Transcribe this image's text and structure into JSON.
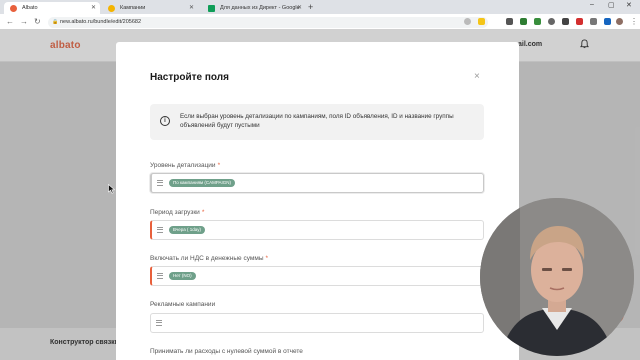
{
  "browser": {
    "tabs": [
      {
        "title": "Albato",
        "favicon_color": "#e8603c",
        "active": true
      },
      {
        "title": "Кампании",
        "favicon_color": "#f4b400",
        "active": false
      },
      {
        "title": "Для данных из Директ - Google",
        "favicon_color": "#0f9d58",
        "active": false
      }
    ],
    "new_tab": "+",
    "url": "new.albato.ru/bundle/edit/205682"
  },
  "app": {
    "logo": "albato",
    "account": "ail.com",
    "builder_title": "Конструктор связки",
    "accent": "#e8603c"
  },
  "modal": {
    "title": "Настройте поля",
    "close": "×",
    "info_icon": "i",
    "info_text": "Если выбран уровень детализации по кампаниям, поля ID объявления, ID и название группы объявлений будут пустыми",
    "fields": [
      {
        "label": "Уровень детализации",
        "required": "*",
        "chip": "По кампаниям (CAMPAIGN)"
      },
      {
        "label": "Период загрузки",
        "required": "*",
        "chip": "Вчера ( 1day)"
      },
      {
        "label": "Включать ли НДС в денежные суммы",
        "required": "*",
        "chip": "Нет (NO)"
      },
      {
        "label": "Рекламные кампании",
        "required": "",
        "chip": ""
      },
      {
        "label": "Принимать ли расходы с нулевой суммой в отчете",
        "required": "",
        "chip": ""
      }
    ]
  }
}
